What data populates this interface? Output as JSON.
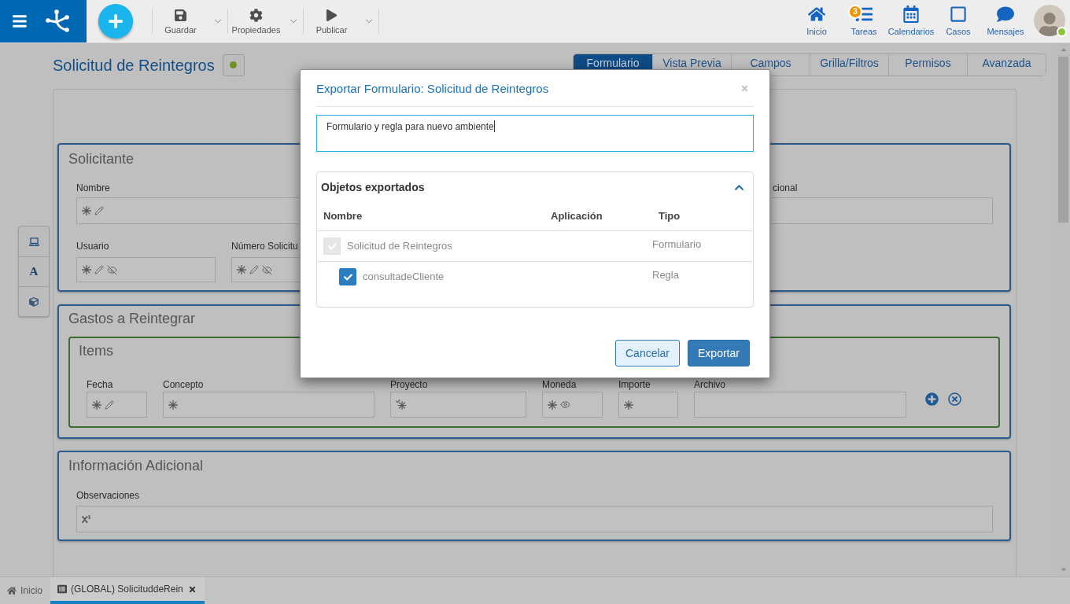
{
  "app_bar": {
    "actions": [
      {
        "label": "Guardar"
      },
      {
        "label": "Propiedades"
      },
      {
        "label": "Publicar"
      }
    ],
    "nav": [
      {
        "label": "Inicio"
      },
      {
        "label": "Tareas",
        "badge": "3"
      },
      {
        "label": "Calendarios"
      },
      {
        "label": "Casos"
      },
      {
        "label": "Mensajes"
      }
    ],
    "user": {
      "online": true
    }
  },
  "page": {
    "title": "Solicitud de Reintegros",
    "tabs": [
      {
        "label": "Formulario",
        "selected": true
      },
      {
        "label": "Vista Previa",
        "selected": false
      },
      {
        "label": "Campos",
        "selected": false
      },
      {
        "label": "Grilla/Filtros",
        "selected": false
      },
      {
        "label": "Permisos",
        "selected": false
      },
      {
        "label": "Avanzada",
        "selected": false
      }
    ]
  },
  "side_toolbar": {
    "text_tool": "A"
  },
  "form": {
    "sections": [
      {
        "title": "Solicitante",
        "rows": [
          [
            {
              "label": "Nombre",
              "required": true,
              "conditional_required": false,
              "editable": true,
              "hidden": false,
              "conditional_visible": false,
              "formatted": false
            },
            {
              "label": "cional",
              "required": false,
              "conditional_required": false,
              "editable": false,
              "hidden": false,
              "conditional_visible": false,
              "formatted": false
            }
          ],
          [
            {
              "label": "Usuario",
              "required": true,
              "conditional_required": false,
              "editable": true,
              "hidden": true,
              "conditional_visible": false,
              "formatted": false
            },
            {
              "label": "Número Solicitu",
              "required": true,
              "conditional_required": false,
              "editable": true,
              "hidden": true,
              "conditional_visible": false,
              "formatted": false
            }
          ]
        ]
      },
      {
        "title": "Gastos a Reintegrar",
        "grid": {
          "title": "Items",
          "columns": [
            {
              "label": "Fecha",
              "required": true,
              "conditional_required": false,
              "editable": true,
              "hidden": false,
              "conditional_visible": false,
              "formatted": false
            },
            {
              "label": "Concepto",
              "required": true,
              "conditional_required": false,
              "editable": false,
              "hidden": false,
              "conditional_visible": false,
              "formatted": false
            },
            {
              "label": "Proyecto",
              "required": false,
              "conditional_required": true,
              "editable": false,
              "hidden": false,
              "conditional_visible": false,
              "formatted": false
            },
            {
              "label": "Moneda",
              "required": true,
              "conditional_required": false,
              "editable": false,
              "hidden": false,
              "conditional_visible": true,
              "formatted": false
            },
            {
              "label": "Importe",
              "required": true,
              "conditional_required": false,
              "editable": false,
              "hidden": false,
              "conditional_visible": false,
              "formatted": false
            },
            {
              "label": "Archivo",
              "required": false,
              "conditional_required": false,
              "editable": false,
              "hidden": false,
              "conditional_visible": false,
              "formatted": false
            }
          ]
        }
      },
      {
        "title": "Información Adicional",
        "rows": [
          [
            {
              "label": "Observaciones",
              "required": false,
              "conditional_required": false,
              "editable": false,
              "hidden": false,
              "conditional_visible": false,
              "formatted": true
            }
          ]
        ]
      }
    ]
  },
  "bottom_tabs": [
    {
      "label": "Inicio",
      "selected": false,
      "closable": false
    },
    {
      "label": "(GLOBAL) SolicituddeRein",
      "selected": true,
      "closable": true
    }
  ],
  "dialog": {
    "title": "Exportar Formulario: Solicitud de Reintegros",
    "note": "Formulario y regla para nuevo ambiente",
    "objects": {
      "title": "Objetos exportados",
      "expanded": true,
      "columns": [
        "Nombre",
        "Aplicación",
        "Tipo"
      ],
      "rows": [
        {
          "name": "Solicitud de Reintegros",
          "type": "Formulario",
          "checked": true,
          "disabled": true,
          "children": [
            {
              "name": "consultadeCliente",
              "type": "Regla",
              "checked": true,
              "disabled": false
            }
          ]
        }
      ]
    },
    "buttons": [
      {
        "label": "Cancelar",
        "kind": "secondary"
      },
      {
        "label": "Exportar",
        "kind": "primary"
      }
    ]
  }
}
